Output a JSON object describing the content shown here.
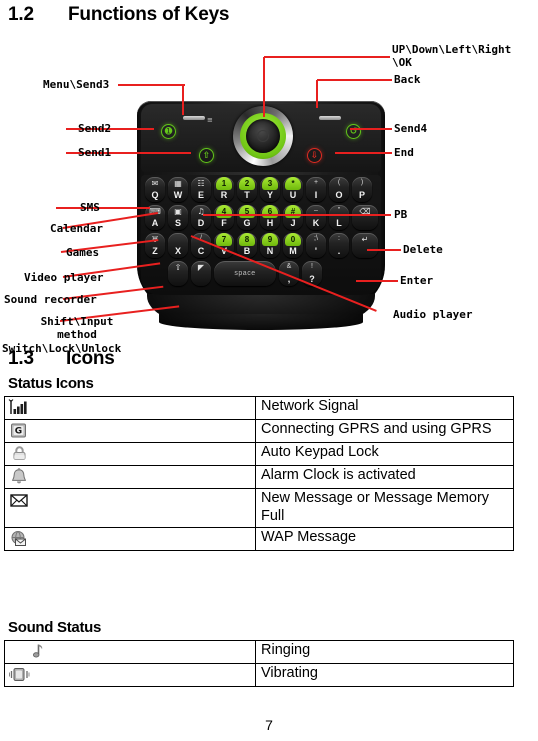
{
  "sections": {
    "keys": {
      "number": "1.2",
      "title": "Functions of Keys"
    },
    "icons": {
      "number": "1.3",
      "title": "Icons"
    },
    "status_icons_heading": "Status Icons",
    "sound_status_heading": "Sound Status"
  },
  "diagram": {
    "callouts": {
      "menu_send3": "Menu\\Send3",
      "updown": "UP\\Down\\Left\\Right\n\\OK",
      "updown_line1": "UP\\Down\\Left\\Right",
      "updown_line2": "\\OK",
      "back": "Back",
      "send2": "Send2",
      "send1": "Send1",
      "sms": "SMS",
      "calendar": "Calendar",
      "games": "Games",
      "video_player": "Video player",
      "sound_recorder": "Sound recorder",
      "shift_input_l1": "Shift\\Input",
      "shift_input_l2": "method",
      "switch_lock": "Switch\\Lock\\Unlock",
      "send4": "Send4",
      "end": "End",
      "pb": "PB",
      "delete": "Delete",
      "enter": "Enter",
      "audio_player": "Audio player"
    },
    "keyboard": {
      "row1": [
        {
          "type": "func",
          "icon": "sms-icon",
          "glyph": "✉",
          "alpha": "Q"
        },
        {
          "type": "func",
          "icon": "calendar-icon",
          "glyph": "▦",
          "alpha": "W"
        },
        {
          "type": "func",
          "icon": "phonebook-icon",
          "glyph": "☷",
          "alpha": "E"
        },
        {
          "type": "num",
          "num": "1",
          "alpha": "R"
        },
        {
          "type": "num",
          "num": "2",
          "alpha": "T"
        },
        {
          "type": "num",
          "num": "3",
          "alpha": "Y"
        },
        {
          "type": "num",
          "num": "*",
          "alpha": "U"
        },
        {
          "type": "sup",
          "sup": "+",
          "alpha": "I"
        },
        {
          "type": "sup",
          "sup": "(",
          "alpha": "O"
        },
        {
          "type": "sup",
          "sup": ")",
          "alpha": "P"
        }
      ],
      "row2": [
        {
          "type": "func",
          "icon": "games-icon",
          "glyph": "⌨",
          "alpha": "A"
        },
        {
          "type": "func",
          "icon": "video-player-icon",
          "glyph": "▣",
          "alpha": "S"
        },
        {
          "type": "func",
          "icon": "audio-player-icon",
          "glyph": "♫",
          "alpha": "D"
        },
        {
          "type": "num",
          "num": "4",
          "alpha": "F"
        },
        {
          "type": "num",
          "num": "5",
          "alpha": "G"
        },
        {
          "type": "num",
          "num": "6",
          "alpha": "H"
        },
        {
          "type": "num",
          "num": "#",
          "alpha": "J"
        },
        {
          "type": "sup",
          "sup": "–",
          "alpha": "K"
        },
        {
          "type": "sup",
          "sup": "”",
          "alpha": "L"
        },
        {
          "type": "funcwide",
          "icon": "delete-icon",
          "glyph": "⌫",
          "alpha": ""
        }
      ],
      "row3": [
        {
          "type": "func",
          "icon": "sound-recorder-icon",
          "glyph": "♅",
          "alpha": "Z"
        },
        {
          "type": "plain",
          "alpha": "X"
        },
        {
          "type": "sup",
          "sup": "/",
          "alpha": "C"
        },
        {
          "type": "num",
          "num": "7",
          "alpha": "V"
        },
        {
          "type": "num",
          "num": "8",
          "alpha": "B"
        },
        {
          "type": "num",
          "num": "9",
          "alpha": "N"
        },
        {
          "type": "num",
          "num": "0",
          "alpha": "M"
        },
        {
          "type": "sup",
          "sup": ";\\",
          "alpha": "'"
        },
        {
          "type": "sup",
          "sup": ":",
          "alpha": "."
        },
        {
          "type": "funcwide",
          "icon": "enter-icon",
          "glyph": "↵",
          "alpha": ""
        }
      ],
      "row4": [
        {
          "type": "func",
          "icon": "shift-input-icon",
          "glyph": "⇧",
          "alpha": ""
        },
        {
          "type": "func",
          "icon": "switch-lock-icon",
          "glyph": "◤",
          "alpha": ""
        },
        {
          "type": "space",
          "alpha": "space"
        },
        {
          "type": "sup",
          "sup": "&",
          "alpha": ","
        },
        {
          "type": "sup",
          "sup": "!",
          "alpha": "?"
        }
      ]
    }
  },
  "status_icons": [
    {
      "icon": "network-signal-icon",
      "label": "Network Signal"
    },
    {
      "icon": "gprs-icon",
      "label": "Connecting GPRS and using GPRS"
    },
    {
      "icon": "keypad-lock-icon",
      "label": "Auto Keypad Lock"
    },
    {
      "icon": "alarm-bell-icon",
      "label": "Alarm Clock is activated"
    },
    {
      "icon": "envelope-icon",
      "label": "New Message or Message Memory Full"
    },
    {
      "icon": "wap-message-icon",
      "label": "WAP Message"
    }
  ],
  "sound_status": [
    {
      "icon": "music-note-icon",
      "label": "Ringing"
    },
    {
      "icon": "vibrate-icon",
      "label": "Vibrating"
    }
  ],
  "footer": {
    "page_number": "7"
  },
  "colors": {
    "leader_line": "#e8201f",
    "key_green": "#8ed41c",
    "send_green": "#63c61a",
    "end_red": "#e02b22",
    "text": "#000000"
  }
}
